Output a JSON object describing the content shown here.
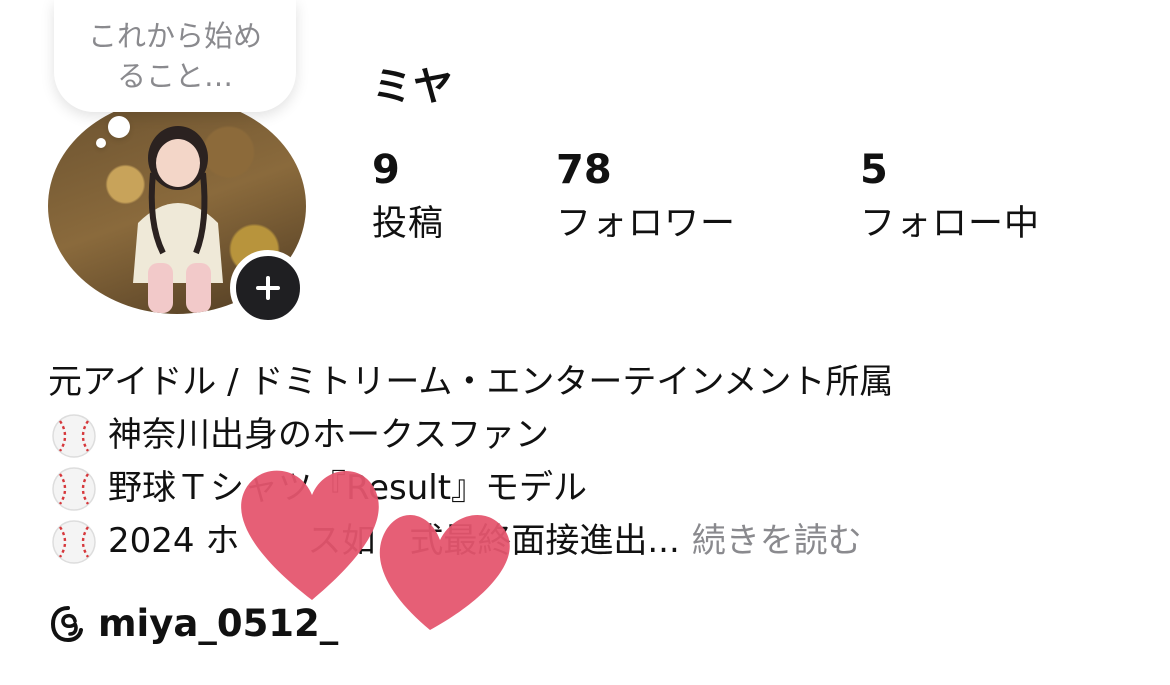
{
  "note": {
    "text_line1": "これから始め",
    "text_line2": "ること…"
  },
  "profile": {
    "name": "ミヤ"
  },
  "stats": [
    {
      "count": "9",
      "label": "投稿"
    },
    {
      "count": "78",
      "label": "フォロワー"
    },
    {
      "count": "5",
      "label": "フォロー中"
    }
  ],
  "bio": {
    "line1": "元アイドル / ドミトリーム・エンターテインメント所属",
    "line2": "神奈川出身のホークスファン",
    "line3": "野球Ｔシャツ『Result』モデル",
    "line4": "2024 ホ　　ス如　式最終面接進出...",
    "more_label": "続きを読む"
  },
  "threads": {
    "handle": "miya_0512_"
  },
  "colors": {
    "text": "#111111",
    "muted": "#8a8a8e",
    "heart": "#e5566f",
    "button_dark": "#1f1f22"
  }
}
